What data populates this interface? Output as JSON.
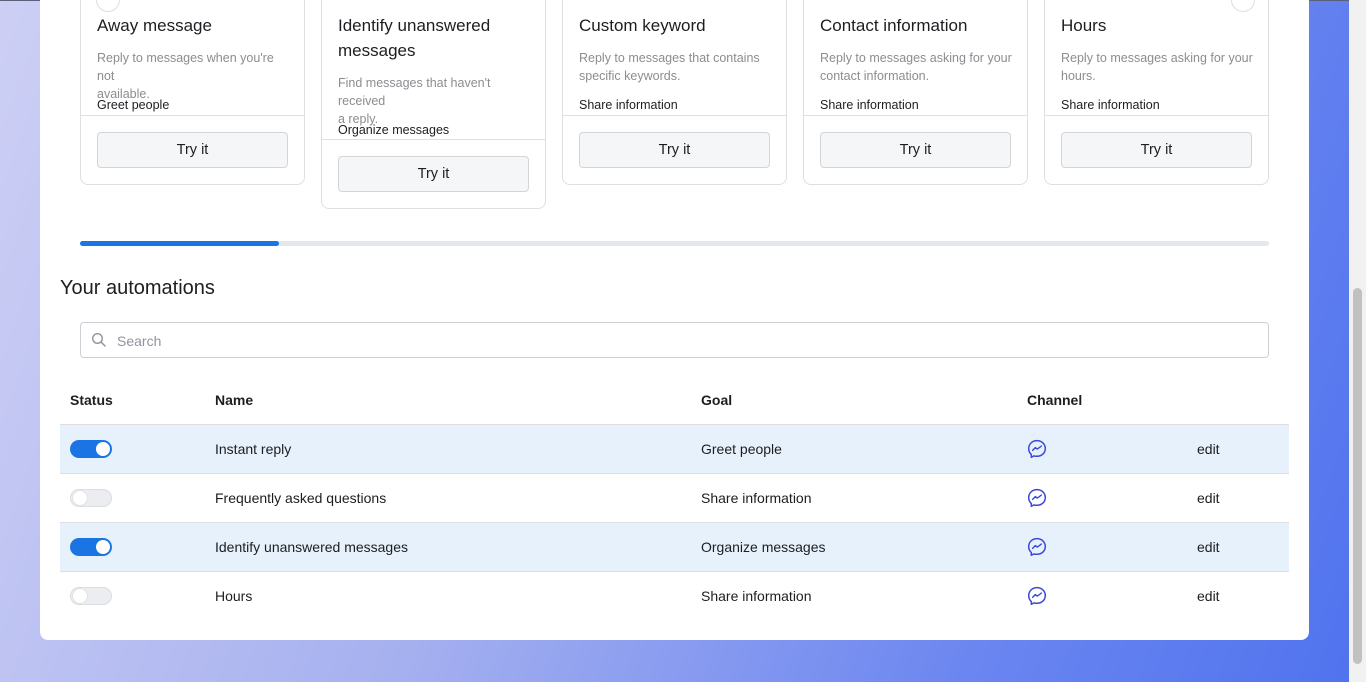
{
  "template_cards": [
    {
      "title_lines": [
        "Away message"
      ],
      "description_lines": [
        "Reply to messages when you're not",
        "available."
      ],
      "goal": "Greet people",
      "button": "Try it"
    },
    {
      "title_lines": [
        "Identify unanswered",
        "messages"
      ],
      "description_lines": [
        "Find messages that haven't received",
        "a reply."
      ],
      "goal": "Organize messages",
      "button": "Try it"
    },
    {
      "title_lines": [
        "Custom keyword"
      ],
      "description_lines": [
        "Reply to messages that contains",
        "specific keywords."
      ],
      "goal": "Share information",
      "button": "Try it"
    },
    {
      "title_lines": [
        "Contact information"
      ],
      "description_lines": [
        "Reply to messages asking for your",
        "contact information."
      ],
      "goal": "Share information",
      "button": "Try it"
    },
    {
      "title_lines": [
        "Hours"
      ],
      "description_lines": [
        "Reply to messages asking for your",
        "hours."
      ],
      "goal": "Share information",
      "button": "Try it"
    }
  ],
  "carousel_progress": 0.167,
  "automations": {
    "title": "Your automations",
    "search_placeholder": "Search",
    "columns": {
      "status": "Status",
      "name": "Name",
      "goal": "Goal",
      "channel": "Channel"
    },
    "rows": [
      {
        "status_on": true,
        "name": "Instant reply",
        "goal": "Greet people",
        "channel_icon": "messenger-icon",
        "action": "edit"
      },
      {
        "status_on": false,
        "name": "Frequently asked questions",
        "goal": "Share information",
        "channel_icon": "messenger-icon",
        "action": "edit"
      },
      {
        "status_on": true,
        "name": "Identify unanswered messages",
        "goal": "Organize messages",
        "channel_icon": "messenger-icon",
        "action": "edit"
      },
      {
        "status_on": false,
        "name": "Hours",
        "goal": "Share information",
        "channel_icon": "messenger-icon",
        "action": "edit"
      }
    ]
  },
  "colors": {
    "accent": "#1b74e4",
    "row_highlight": "#e7f1fb",
    "messenger_icon": "#3b48d8"
  }
}
